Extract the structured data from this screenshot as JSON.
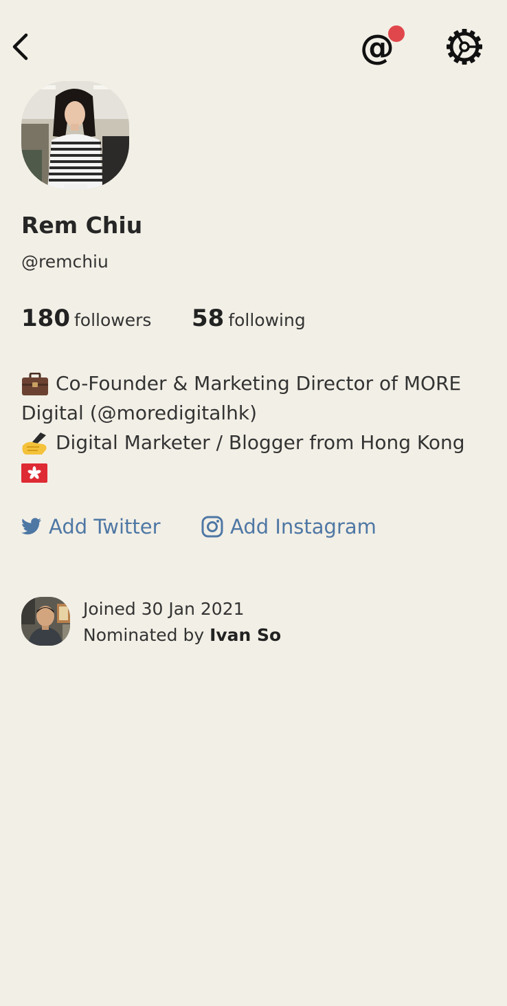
{
  "header": {
    "back_icon": "chevron-left-icon",
    "mention_icon": "at-sign-icon",
    "mention_badge_color": "#e0474c",
    "settings_icon": "gear-icon"
  },
  "profile": {
    "name": "Rem Chiu",
    "handle": "@remchiu",
    "followers_count": "180",
    "followers_label": "followers",
    "following_count": "58",
    "following_label": "following",
    "bio": [
      {
        "emoji": "briefcase",
        "text": "Co-Founder & Marketing Director of MORE"
      },
      {
        "emoji": "",
        "text": "Digital (@moredigitalhk)"
      },
      {
        "emoji": "writing-hand",
        "text": "Digital Marketer / Blogger from Hong Kong"
      },
      {
        "emoji": "hong-kong-flag",
        "text": ""
      }
    ]
  },
  "social": {
    "twitter_label": "Add Twitter",
    "instagram_label": "Add Instagram",
    "link_color": "#4e77a4"
  },
  "membership": {
    "joined_text": "Joined 30 Jan 2021",
    "nominated_prefix": "Nominated by",
    "nominator_name": "Ivan So"
  }
}
